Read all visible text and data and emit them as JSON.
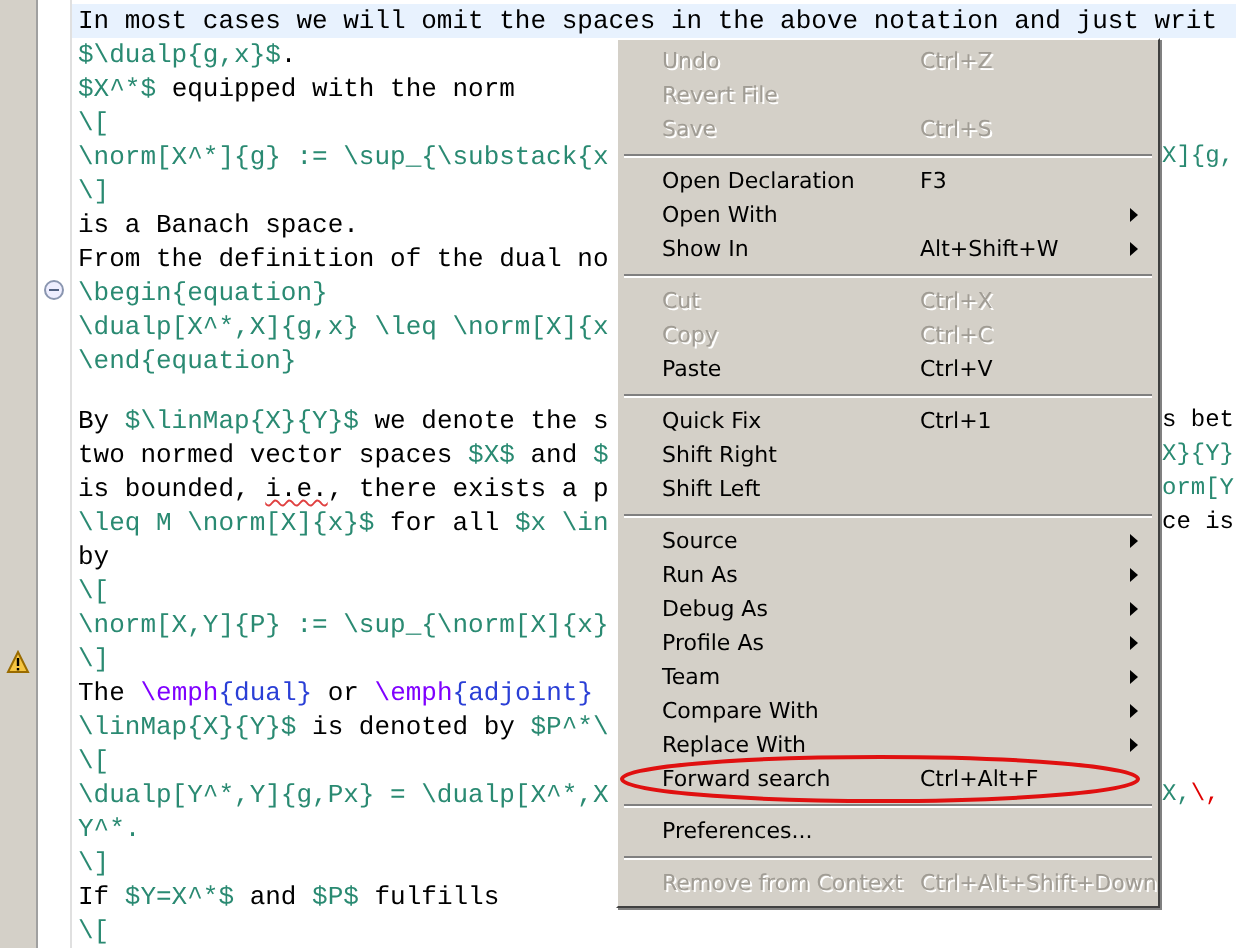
{
  "editor": {
    "lines": [
      {
        "current": true,
        "left": [
          {
            "kind": "text",
            "text": "In most cases we will omit the spaces in the above notation and just writ"
          }
        ]
      },
      {
        "current": false,
        "left": [
          {
            "kind": "math",
            "text": "$\\dualp{g,x}$"
          },
          {
            "kind": "text",
            "text": "."
          }
        ]
      },
      {
        "current": false,
        "left": [
          {
            "kind": "math",
            "text": "$X^*$"
          },
          {
            "kind": "text",
            "text": " equipped with the norm"
          }
        ]
      },
      {
        "current": false,
        "left": [
          {
            "kind": "math",
            "text": "\\["
          }
        ]
      },
      {
        "current": false,
        "left": [
          {
            "kind": "math",
            "text": "\\norm[X^*]{g} := \\sup_{\\substack{x"
          }
        ],
        "right": [
          {
            "kind": "math",
            "text": "X]{g,"
          }
        ]
      },
      {
        "current": false,
        "left": [
          {
            "kind": "math",
            "text": "\\]"
          }
        ]
      },
      {
        "current": false,
        "left": [
          {
            "kind": "text",
            "text": "is a Banach space."
          }
        ]
      },
      {
        "current": false,
        "left": [
          {
            "kind": "text",
            "text": "From the definition of the dual no"
          }
        ]
      },
      {
        "current": false,
        "fold_expanded": true,
        "left": [
          {
            "kind": "math",
            "text": "\\begin{equation}"
          }
        ]
      },
      {
        "current": false,
        "left": [
          {
            "kind": "math",
            "text": "\\dualp[X^*,X]{g,x} \\leq \\norm[X]{x"
          }
        ]
      },
      {
        "current": false,
        "left": [
          {
            "kind": "math",
            "text": "\\end{equation}"
          }
        ]
      },
      {
        "current": false
      },
      {
        "current": false,
        "left": [
          {
            "kind": "text",
            "text": "By "
          },
          {
            "kind": "math",
            "text": "$\\linMap{X}{Y}$"
          },
          {
            "kind": "text",
            "text": " we denote the s"
          }
        ],
        "right": [
          {
            "kind": "text",
            "text": "s bet"
          }
        ]
      },
      {
        "current": false,
        "left": [
          {
            "kind": "text",
            "text": "two normed vector spaces "
          },
          {
            "kind": "math",
            "text": "$X$"
          },
          {
            "kind": "text",
            "text": " and "
          },
          {
            "kind": "math",
            "text": "$"
          }
        ],
        "right": [
          {
            "kind": "math",
            "text": "X}{Y}"
          }
        ]
      },
      {
        "current": false,
        "left": [
          {
            "kind": "text",
            "text": "is bounded, "
          },
          {
            "kind": "misspelled",
            "text": "i.e."
          },
          {
            "kind": "text",
            "text": ", there exists a p"
          }
        ],
        "right": [
          {
            "kind": "math",
            "text": "orm[Y"
          }
        ]
      },
      {
        "current": false,
        "left": [
          {
            "kind": "math",
            "text": "\\leq M \\norm[X]{x}$"
          },
          {
            "kind": "text",
            "text": " for all "
          },
          {
            "kind": "math",
            "text": "$x \\in"
          }
        ],
        "right": [
          {
            "kind": "text",
            "text": "ce is"
          }
        ]
      },
      {
        "current": false,
        "left": [
          {
            "kind": "text",
            "text": "by"
          }
        ]
      },
      {
        "current": false,
        "left": [
          {
            "kind": "math",
            "text": "\\["
          }
        ]
      },
      {
        "current": false,
        "left": [
          {
            "kind": "math",
            "text": "\\norm[X,Y]{P} := \\sup_{\\norm[X]{x}"
          }
        ]
      },
      {
        "current": false,
        "warning": true,
        "left": [
          {
            "kind": "math",
            "text": "\\]"
          }
        ]
      },
      {
        "current": false,
        "left": [
          {
            "kind": "text",
            "text": "The "
          },
          {
            "kind": "command",
            "text": "\\emph"
          },
          {
            "kind": "arg",
            "text": "{dual}"
          },
          {
            "kind": "text",
            "text": " or "
          },
          {
            "kind": "command",
            "text": "\\emph"
          },
          {
            "kind": "arg",
            "text": "{adjoint}"
          }
        ]
      },
      {
        "current": false,
        "left": [
          {
            "kind": "math",
            "text": "\\linMap{X}{Y}$"
          },
          {
            "kind": "text",
            "text": " is denoted by "
          },
          {
            "kind": "math",
            "text": "$P^*\\"
          }
        ]
      },
      {
        "current": false,
        "left": [
          {
            "kind": "math",
            "text": "\\["
          }
        ]
      },
      {
        "current": false,
        "left": [
          {
            "kind": "math",
            "text": "\\dualp[Y^*,Y]{g,Px} = \\dualp[X^*,X"
          }
        ],
        "right": [
          {
            "kind": "math",
            "text": "X,"
          },
          {
            "kind": "error",
            "text": "\\,"
          }
        ]
      },
      {
        "current": false,
        "left": [
          {
            "kind": "math",
            "text": "Y^*."
          }
        ]
      },
      {
        "current": false,
        "left": [
          {
            "kind": "math",
            "text": "\\]"
          }
        ]
      },
      {
        "current": false,
        "left": [
          {
            "kind": "text",
            "text": "If "
          },
          {
            "kind": "math",
            "text": "$Y=X^*$"
          },
          {
            "kind": "text",
            "text": " and "
          },
          {
            "kind": "math",
            "text": "$P$"
          },
          {
            "kind": "text",
            "text": " fulfills"
          }
        ]
      },
      {
        "current": false,
        "left": [
          {
            "kind": "math",
            "text": "\\["
          }
        ]
      }
    ]
  },
  "context_menu": [
    {
      "kind": "item",
      "label": "Undo",
      "shortcut": "Ctrl+Z",
      "disabled": true,
      "submenu": false,
      "circled": false
    },
    {
      "kind": "item",
      "label": "Revert File",
      "disabled": true,
      "submenu": false,
      "circled": false
    },
    {
      "kind": "item",
      "label": "Save",
      "shortcut": "Ctrl+S",
      "disabled": true,
      "submenu": false,
      "circled": false
    },
    {
      "kind": "separator"
    },
    {
      "kind": "item",
      "label": "Open Declaration",
      "shortcut": "F3",
      "disabled": false,
      "submenu": false,
      "circled": false
    },
    {
      "kind": "item",
      "label": "Open With",
      "disabled": false,
      "submenu": true,
      "circled": false
    },
    {
      "kind": "item",
      "label": "Show In",
      "shortcut": "Alt+Shift+W",
      "disabled": false,
      "submenu": true,
      "circled": false
    },
    {
      "kind": "separator"
    },
    {
      "kind": "item",
      "label": "Cut",
      "shortcut": "Ctrl+X",
      "disabled": true,
      "submenu": false,
      "circled": false
    },
    {
      "kind": "item",
      "label": "Copy",
      "shortcut": "Ctrl+C",
      "disabled": true,
      "submenu": false,
      "circled": false
    },
    {
      "kind": "item",
      "label": "Paste",
      "shortcut": "Ctrl+V",
      "disabled": false,
      "submenu": false,
      "circled": false
    },
    {
      "kind": "separator"
    },
    {
      "kind": "item",
      "label": "Quick Fix",
      "shortcut": "Ctrl+1",
      "disabled": false,
      "submenu": false,
      "circled": false
    },
    {
      "kind": "item",
      "label": "Shift Right",
      "disabled": false,
      "submenu": false,
      "circled": false
    },
    {
      "kind": "item",
      "label": "Shift Left",
      "disabled": false,
      "submenu": false,
      "circled": false
    },
    {
      "kind": "separator"
    },
    {
      "kind": "item",
      "label": "Source",
      "disabled": false,
      "submenu": true,
      "circled": false
    },
    {
      "kind": "item",
      "label": "Run As",
      "disabled": false,
      "submenu": true,
      "circled": false
    },
    {
      "kind": "item",
      "label": "Debug As",
      "disabled": false,
      "submenu": true,
      "circled": false
    },
    {
      "kind": "item",
      "label": "Profile As",
      "disabled": false,
      "submenu": true,
      "circled": false
    },
    {
      "kind": "item",
      "label": "Team",
      "disabled": false,
      "submenu": true,
      "circled": false
    },
    {
      "kind": "item",
      "label": "Compare With",
      "disabled": false,
      "submenu": true,
      "circled": false
    },
    {
      "kind": "item",
      "label": "Replace With",
      "disabled": false,
      "submenu": true,
      "circled": false
    },
    {
      "kind": "item",
      "label": "Forward search",
      "shortcut": "Ctrl+Alt+F",
      "disabled": false,
      "submenu": false,
      "circled": true
    },
    {
      "kind": "separator"
    },
    {
      "kind": "item",
      "label": "Preferences...",
      "disabled": false,
      "submenu": false,
      "circled": false
    },
    {
      "kind": "separator"
    },
    {
      "kind": "item",
      "label": "Remove from Context",
      "shortcut": "Ctrl+Alt+Shift+Down",
      "disabled": true,
      "submenu": false,
      "circled": false
    }
  ]
}
